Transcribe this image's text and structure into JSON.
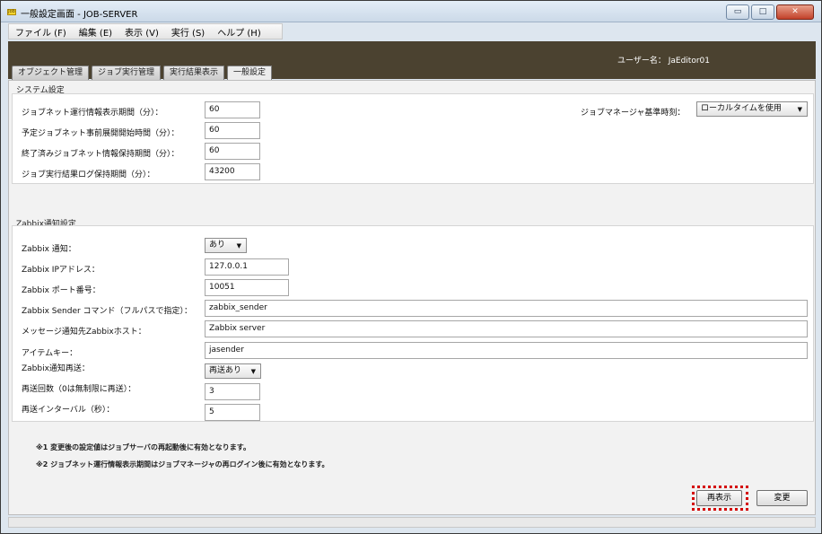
{
  "window": {
    "title": "一般設定画面 - JOB-SERVER",
    "app_icon_text": "Job",
    "minimize": "▭",
    "maximize": "□",
    "close": "✕"
  },
  "menu": [
    "ファイル (F)",
    "編集 (E)",
    "表示 (V)",
    "実行 (S)",
    "ヘルプ (H)"
  ],
  "header": {
    "user": "ユーザー名： JaEditor01"
  },
  "tabs": [
    "オブジェクト管理",
    "ジョブ実行管理",
    "実行結果表示",
    "一般設定"
  ],
  "system": {
    "title": "システム設定",
    "fields": [
      {
        "label": "ジョブネット運行情報表示期間（分）：",
        "value": "60"
      },
      {
        "label": "予定ジョブネット事前展開開始時間（分）：",
        "value": "60"
      },
      {
        "label": "終了済みジョブネット情報保持期間（分）：",
        "value": "60"
      },
      {
        "label": "ジョブ実行結果ログ保持期間（分）：",
        "value": "43200"
      }
    ],
    "time_label": "ジョブマネージャ基準時刻：",
    "time_value": "ローカルタイムを使用"
  },
  "zabbix": {
    "title": "Zabbix通知設定",
    "notify_label": "Zabbix 通知：",
    "notify_value": "あり",
    "ip_label": "Zabbix IPアドレス：",
    "ip_value": "127.0.0.1",
    "port_label": "Zabbix ポート番号：",
    "port_value": "10051",
    "sender_label": "Zabbix Sender コマンド（フルパスで指定）：",
    "sender_value": "zabbix_sender",
    "host_label": "メッセージ通知先Zabbixホスト：",
    "host_value": "Zabbix server",
    "item_label": "アイテムキー：",
    "item_value": "jasender",
    "resend_label": "Zabbix通知再送：",
    "resend_value": "再送あり",
    "count_label": "再送回数（0は無制限に再送）：",
    "count_value": "3",
    "interval_label": "再送インターバル（秒）：",
    "interval_value": "5"
  },
  "notes": [
    "※1 変更後の設定値はジョブサーバの再起動後に有効となります。",
    "※2 ジョブネット運行情報表示期間はジョブマネージャの再ログイン後に有効となります。"
  ],
  "buttons": {
    "refresh": "再表示",
    "change": "変更"
  },
  "colors": {
    "header_bg": "#4b4230",
    "highlight": "#d40000"
  }
}
